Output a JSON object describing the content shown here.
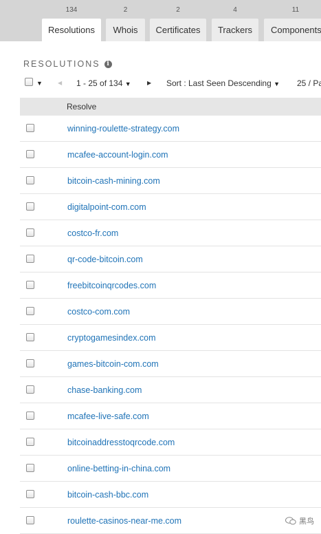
{
  "tabs": [
    {
      "label": "Resolutions",
      "count": "134",
      "active": true
    },
    {
      "label": "Whois",
      "count": "2",
      "active": false
    },
    {
      "label": "Certificates",
      "count": "2",
      "active": false
    },
    {
      "label": "Trackers",
      "count": "4",
      "active": false
    },
    {
      "label": "Components",
      "count": "11",
      "active": false
    }
  ],
  "section": {
    "title": "RESOLUTIONS"
  },
  "toolbar": {
    "pagination": "1 - 25 of 134",
    "sort": "Sort : Last Seen Descending",
    "per_page": "25 / Pa"
  },
  "table": {
    "header": "Resolve",
    "rows": [
      "winning-roulette-strategy.com",
      "mcafee-account-login.com",
      "bitcoin-cash-mining.com",
      "digitalpoint-com.com",
      "costco-fr.com",
      "qr-code-bitcoin.com",
      "freebitcoinqrcodes.com",
      "costco-com.com",
      "cryptogamesindex.com",
      "games-bitcoin-com.com",
      "chase-banking.com",
      "mcafee-live-safe.com",
      "bitcoinaddresstoqrcode.com",
      "online-betting-in-china.com",
      "bitcoin-cash-bbc.com",
      "roulette-casinos-near-me.com"
    ]
  },
  "watermark": {
    "text": "黑鸟"
  },
  "colors": {
    "link": "#1f73b7",
    "tabbar": "#d5d5d5",
    "header_bg": "#e6e6e6"
  }
}
